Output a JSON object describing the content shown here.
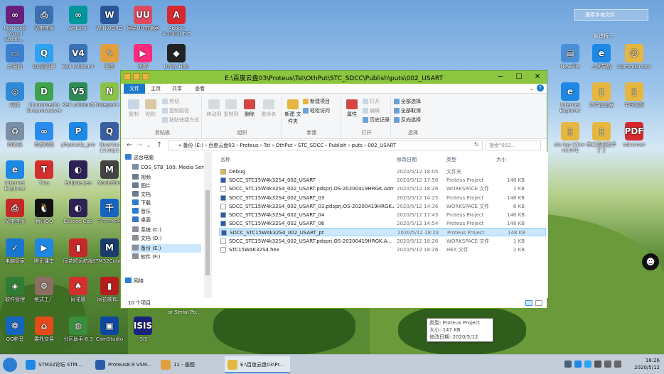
{
  "desktop_icons": [
    {
      "label": "Microsoft Visual Studio...",
      "color": "#68217a",
      "glyph": "∞"
    },
    {
      "label": "宽带连接",
      "color": "#3a6fb0",
      "glyph": "⎙"
    },
    {
      "label": "Arduino",
      "color": "#00979c",
      "glyph": "∞"
    },
    {
      "label": "WINWORD",
      "color": "#2b579a",
      "glyph": "W"
    },
    {
      "label": "网易UU加速器",
      "color": "#e04a5f",
      "glyph": "UU"
    },
    {
      "label": "Adobe Acrobat DC",
      "color": "#d7282f",
      "glyph": "A"
    },
    {
      "label": "此电脑",
      "color": "#3b7fd1",
      "glyph": "▭"
    },
    {
      "label": "QQ浏览器",
      "color": "#2da3f2",
      "glyph": "Q"
    },
    {
      "label": "Keil uVision4",
      "color": "#3b72b6",
      "glyph": "V4"
    },
    {
      "label": "画图",
      "color": "#e0a040",
      "glyph": "✎"
    },
    {
      "label": "优酷",
      "color": "#ff2a7b",
      "glyph": "▶"
    },
    {
      "label": "Unity Hub",
      "color": "#222222",
      "glyph": "◆"
    },
    {
      "label": "网络",
      "color": "#2f8ad8",
      "glyph": "◎"
    },
    {
      "label": "Macromedia Dreamweaver",
      "color": "#3fa34d",
      "glyph": "D"
    },
    {
      "label": "Keil uVision5",
      "color": "#2e8b57",
      "glyph": "V5"
    },
    {
      "label": "Notepad++",
      "color": "#8bc34a",
      "glyph": "N"
    },
    {
      "label": "回收站",
      "color": "#7b8fa5",
      "glyph": "♻"
    },
    {
      "label": "百度网盘",
      "color": "#2a8cf0",
      "glyph": "∞"
    },
    {
      "label": "phpstudy_pro",
      "color": "#1e88e5",
      "glyph": "P"
    },
    {
      "label": "Quartus 13.0sp1",
      "color": "#3a5fa0",
      "glyph": "Q"
    },
    {
      "label": "Internet Explorer",
      "color": "#1e88e5",
      "glyph": "e"
    },
    {
      "label": "Tina",
      "color": "#d32f2f",
      "glyph": "T"
    },
    {
      "label": "Eclipse Jee",
      "color": "#2c2255",
      "glyph": "◐"
    },
    {
      "label": "ModelSim",
      "color": "#444444",
      "glyph": "M"
    },
    {
      "label": "宽带连接",
      "color": "#c62828",
      "glyph": "⎙"
    },
    {
      "label": "腾讯QQ",
      "color": "#111111",
      "glyph": "🐧"
    },
    {
      "label": "Eclipse Cpp",
      "color": "#2c2255",
      "glyph": "◐"
    },
    {
      "label": "千牛工作台",
      "color": "#1565c0",
      "glyph": "千"
    },
    {
      "label": "电脑管家",
      "color": "#1976d2",
      "glyph": "✓"
    },
    {
      "label": "腾讯课堂",
      "color": "#1e88e5",
      "glyph": "▶"
    },
    {
      "label": "同花顺远航版",
      "color": "#c62828",
      "glyph": "▮"
    },
    {
      "label": "STM32CubeMX",
      "color": "#1a3b6b",
      "glyph": "M"
    },
    {
      "label": "软件管理",
      "color": "#2e7d32",
      "glyph": "◈"
    },
    {
      "label": "格式工厂",
      "color": "#8d6e63",
      "glyph": "⚙"
    },
    {
      "label": "同花顺",
      "color": "#d32f2f",
      "glyph": "♠"
    },
    {
      "label": "同花顺有...",
      "color": "#b71c1c",
      "glyph": "▮"
    },
    {
      "label": "QQ影音",
      "color": "#1565c0",
      "glyph": "❁"
    },
    {
      "label": "委托交易",
      "color": "#e64a19",
      "glyph": "⌂"
    },
    {
      "label": "分区助手 8.3",
      "color": "#388e3c",
      "glyph": "◍"
    },
    {
      "label": "CamStudio",
      "color": "#0d47a1",
      "glyph": "▣"
    },
    {
      "label": "ISIS",
      "color": "#1a237e",
      "glyph": "ISIS"
    }
  ],
  "right_icons": [
    {
      "label": "NewFile",
      "color": "#4a90d9",
      "glyph": "▤"
    },
    {
      "label": "上网导航",
      "color": "#1e88e5",
      "glyph": "e"
    },
    {
      "label": "Administrator",
      "color": "#e6b740",
      "glyph": "☺"
    },
    {
      "label": "Internet Explorer",
      "color": "#1e88e5",
      "glyph": "e"
    },
    {
      "label": "文件创建器",
      "color": "#e6b740",
      "glyph": "▯"
    },
    {
      "label": "中间视频",
      "color": "#e6b740",
      "glyph": "▯"
    },
    {
      "label": "stc-isp-15xx-v6.87E",
      "color": "#e6b740",
      "glyph": "▯"
    },
    {
      "label": "串口调试助手丁丁",
      "color": "#e6b740",
      "glyph": "▯"
    },
    {
      "label": "sdccman",
      "color": "#d7282f",
      "glyph": "PDF"
    }
  ],
  "right_search": "搜索本地文件",
  "new_folder_label": "新建桥子",
  "explorer": {
    "title": "E:\\百度云盘03\\Proteus\\Tst\\OthPut\\STC_SDCC\\Publish\\puts\\002_USART",
    "tabs": [
      "文件",
      "主页",
      "共享",
      "查看"
    ],
    "ribbon": {
      "clipboard": {
        "label": "剪贴板",
        "copy_path": "复制路径",
        "paste_shortcut": "粘贴快捷方式",
        "cut": "剪切",
        "copy": "复制",
        "paste": "粘贴"
      },
      "organize": {
        "label": "组织",
        "move_to": "移动到",
        "copy_to": "复制到",
        "delete": "删除",
        "rename": "重命名"
      },
      "new": {
        "label": "新建",
        "new_item": "新建项目",
        "easy_access": "轻松访问",
        "new_folder": "新建\n文件夹"
      },
      "open": {
        "label": "打开",
        "open": "打开",
        "edit": "编辑",
        "history": "历史记录",
        "properties": "属性"
      },
      "select": {
        "label": "选择",
        "select_all": "全部选择",
        "select_none": "全部取消",
        "invert": "反向选择"
      }
    },
    "path_segments": [
      "«",
      "备份 (E:)",
      "百度云盘03",
      "Proteus",
      "Tst",
      "OthPut",
      "STC_SDCC",
      "Publish",
      "puts",
      "002_USART"
    ],
    "search_placeholder": "搜索\"002...",
    "nav": [
      {
        "label": "这台电脑",
        "color": "#3b7fd1"
      },
      {
        "label": "COS_STB_100: Media Serv",
        "color": "#7a8fa8"
      },
      {
        "label": "视频",
        "color": "#6a7d91"
      },
      {
        "label": "图片",
        "color": "#6a7d91"
      },
      {
        "label": "文档",
        "color": "#6a7d91"
      },
      {
        "label": "下载",
        "color": "#2a7fd4"
      },
      {
        "label": "音乐",
        "color": "#2a7fd4"
      },
      {
        "label": "桌面",
        "color": "#3a75c4"
      },
      {
        "label": "系统 (C:)",
        "color": "#8a8f98"
      },
      {
        "label": "文档 (D:)",
        "color": "#8a8f98"
      },
      {
        "label": "备份 (E:)",
        "color": "#8a8f98"
      },
      {
        "label": "软件 (F:)",
        "color": "#8a8f98"
      },
      {
        "label": "网络",
        "color": "#2a7fd4"
      }
    ],
    "columns": {
      "name": "名称",
      "date": "修改日期",
      "type": "类型",
      "size": "大小"
    },
    "files": [
      {
        "name": "Debug",
        "date": "2020/5/12 18:05",
        "type": "文件夹",
        "size": "",
        "icon": "#e6b740"
      },
      {
        "name": "SDCC_STC15W4k32S4_002_USART",
        "date": "2020/5/12 17:50",
        "type": "Proteus Project",
        "size": "148 KB",
        "icon": "#2a5ca8"
      },
      {
        "name": "SDCC_STC15W4k32S4_002_USART.pdsprj.OS-20200419HRGK.Adm...",
        "date": "2020/5/12 18:26",
        "type": "WORKSPACE 文件",
        "size": "1 KB",
        "icon": "#ffffff"
      },
      {
        "name": "SDCC_STC15W4k32S4_002_USART_03",
        "date": "2020/5/12 14:25",
        "type": "Proteus Project",
        "size": "148 KB",
        "icon": "#2a5ca8"
      },
      {
        "name": "SDCC_STC15W4k32S4_002_USART_03.pdsprj.OS-20200419HRGK.A...",
        "date": "2020/5/12 14:36",
        "type": "WORKSPACE 文件",
        "size": "6 KB",
        "icon": "#ffffff"
      },
      {
        "name": "SDCC_STC15W4k32S4_002_USART_04",
        "date": "2020/5/12 17:43",
        "type": "Proteus Project",
        "size": "146 KB",
        "icon": "#2a5ca8"
      },
      {
        "name": "SDCC_STC15W4k32S4_002_USART_06",
        "date": "2020/5/12 14:54",
        "type": "Proteus Project",
        "size": "148 KB",
        "icon": "#2a5ca8"
      },
      {
        "name": "SDCC_STC15W4k32S4_002_USART_pt",
        "date": "2020/5/12 18:24",
        "type": "Proteus Project",
        "size": "148 KB",
        "icon": "#2a5ca8"
      },
      {
        "name": "SDCC_STC15W4k32S4_002_USART.pdsprj.OS-20200419HRGK.A...",
        "date": "2020/5/12 18:26",
        "type": "WORKSPACE 文件",
        "size": "1 KB",
        "icon": "#ffffff"
      },
      {
        "name": "STC15W4K32S4.hex",
        "date": "2020/5/12 18:26",
        "type": "HEX 文件",
        "size": "2 KB",
        "icon": "#ffffff"
      }
    ],
    "selected_index": 7,
    "tooltip": {
      "type": "类型: Proteus Project",
      "size": "大小: 147 KB",
      "date": "修改日期: 2020/5/12 18:24"
    },
    "status": "10 个项目"
  },
  "taskbar": {
    "items": [
      {
        "label": "STM32论坛 STM...",
        "color": "#1e88e5"
      },
      {
        "label": "Proteus8.9 VSM...",
        "color": "#2a5ca8"
      },
      {
        "label": "11 - 画图",
        "color": "#e0a040"
      },
      {
        "label": "E:\\百度云盘03\\Pr...",
        "color": "#e6b740"
      }
    ],
    "time": "18:26",
    "date": "2020/5/12"
  },
  "desktop_caption": "ar Serial Po..."
}
